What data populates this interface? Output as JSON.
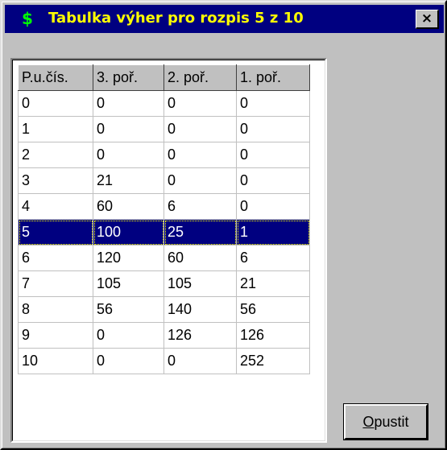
{
  "window": {
    "title": "Tabulka výher pro rozpis 5 z 10",
    "title_icon_glyph": "$",
    "title_icon_name": "dollar-icon",
    "close_glyph": "×"
  },
  "table": {
    "columns": [
      "P.u.čís.",
      "3. poř.",
      "2. poř.",
      "1. poř."
    ],
    "rows": [
      [
        "0",
        "0",
        "0",
        "0"
      ],
      [
        "1",
        "0",
        "0",
        "0"
      ],
      [
        "2",
        "0",
        "0",
        "0"
      ],
      [
        "3",
        "21",
        "0",
        "0"
      ],
      [
        "4",
        "60",
        "6",
        "0"
      ],
      [
        "5",
        "100",
        "25",
        "1"
      ],
      [
        "6",
        "120",
        "60",
        "6"
      ],
      [
        "7",
        "105",
        "105",
        "21"
      ],
      [
        "8",
        "56",
        "140",
        "56"
      ],
      [
        "9",
        "0",
        "126",
        "126"
      ],
      [
        "10",
        "0",
        "0",
        "252"
      ]
    ],
    "selected_row": 5
  },
  "buttons": {
    "exit_accel": "O",
    "exit_rest": "pustit"
  },
  "colors": {
    "titlebar": "#000080",
    "title_text": "#ffff00",
    "title_icon": "#00ff00",
    "selection": "#000080",
    "face": "#c0c0c0"
  }
}
